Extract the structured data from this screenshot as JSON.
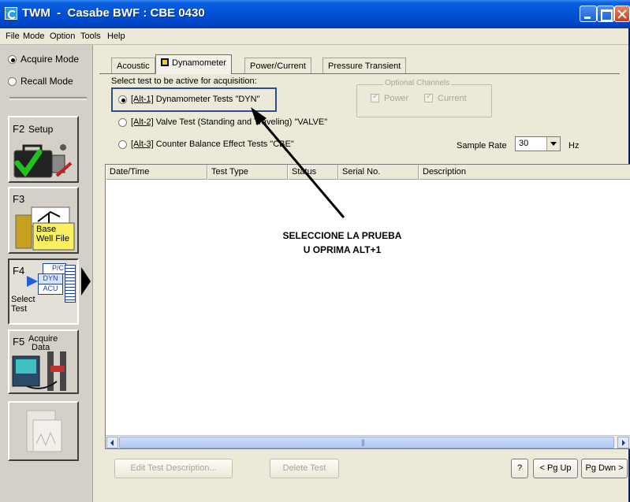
{
  "window": {
    "title": "TWM  -  Casabe BWF : CBE 0430"
  },
  "menu": [
    "File",
    "Mode",
    "Option",
    "Tools",
    "Help"
  ],
  "left_panel": {
    "modes": [
      {
        "label": "Acquire Mode",
        "checked": true
      },
      {
        "label": "Recall Mode",
        "checked": false
      }
    ],
    "f2": {
      "key": "F2",
      "label": "Setup"
    },
    "f3": {
      "key": "F3",
      "label_line1": "Base",
      "label_line2": "Well File"
    },
    "f4": {
      "key": "F4",
      "label_line1": "Select",
      "label_line2": "Test",
      "tags": [
        "P/C",
        "DYN",
        "ACU"
      ]
    },
    "f5": {
      "key": "F5",
      "label_line1": "Acquire",
      "label_line2": "Data"
    }
  },
  "tabs": [
    {
      "label": "Acoustic",
      "active": false
    },
    {
      "label": "Dynamometer",
      "active": true
    },
    {
      "label": "Power/Current",
      "active": false
    },
    {
      "label": "Pressure Transient",
      "active": false
    }
  ],
  "test_select": {
    "heading": "Select test to be active for acquisition:",
    "options": [
      {
        "key": "[Alt-1]",
        "text": " Dynamometer Tests  \"DYN\"",
        "checked": true
      },
      {
        "key": "[Alt-2]",
        "text": " Valve Test (Standing and Traveling)  \"VALVE\"",
        "checked": false
      },
      {
        "key": "[Alt-3]",
        "text": " Counter Balance Effect Tests  \"CBE\"",
        "checked": false
      }
    ]
  },
  "optional_channels": {
    "title": "Optional Channels",
    "power": "Power",
    "current": "Current"
  },
  "sample_rate": {
    "label": "Sample Rate",
    "value": "30",
    "unit": "Hz"
  },
  "table": {
    "columns": [
      "Date/Time",
      "Test Type",
      "Status",
      "Serial No.",
      "Description"
    ],
    "rows": []
  },
  "annotation": {
    "line1": "SELECCIONE LA PRUEBA",
    "line2": "U OPRIMA ALT+1"
  },
  "buttons": {
    "edit": "Edit Test Description...",
    "delete": "Delete Test",
    "help": "?",
    "pgup": "< Pg Up",
    "pgdn": "Pg Dwn >"
  }
}
